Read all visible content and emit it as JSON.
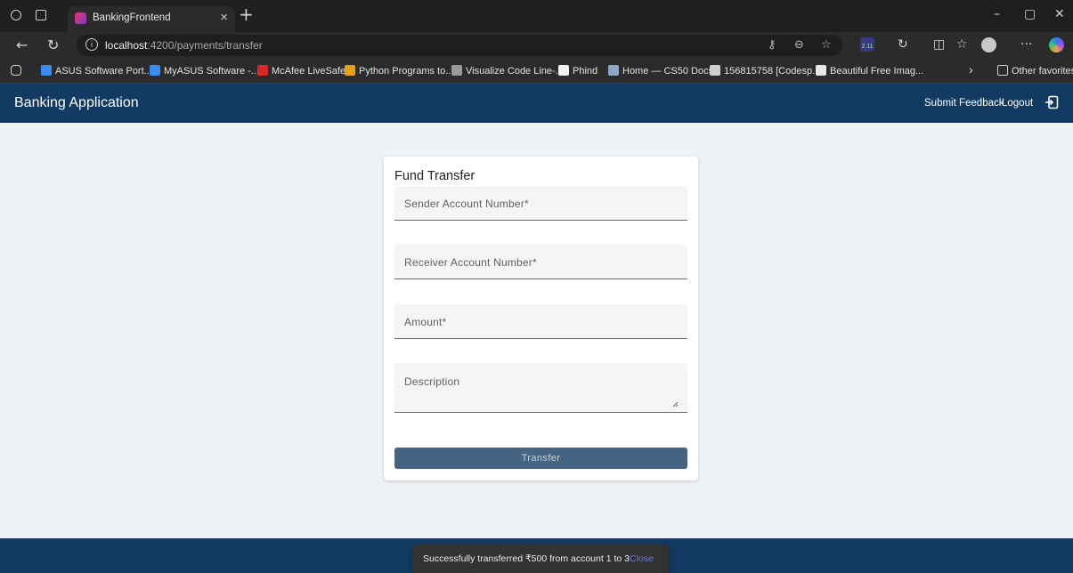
{
  "browser": {
    "tab_title": "BankingFrontend",
    "tab_close": "×",
    "new_tab": "+",
    "url_host": "localhost",
    "url_path": ":4200/payments/transfer",
    "extension_badge": "2.11",
    "window_controls": {
      "minimize": "–",
      "restore": "▢",
      "close": "✕"
    }
  },
  "bookmarks": [
    {
      "label": "ASUS Software Port...",
      "icon": "asus-icon",
      "color": "#3b8cf0"
    },
    {
      "label": "MyASUS Software -...",
      "icon": "asus-icon",
      "color": "#3b8cf0"
    },
    {
      "label": "McAfee LiveSafe",
      "icon": "mcafee-icon",
      "color": "#d92626"
    },
    {
      "label": "Python Programs to...",
      "icon": "python-icon",
      "color": "#e3a21a"
    },
    {
      "label": "Visualize Code Line-...",
      "icon": "visualize-icon",
      "color": "#9a9a9a"
    },
    {
      "label": "Phind",
      "icon": "phind-icon",
      "color": "#f2f2f2"
    },
    {
      "label": "Home — CS50 Docs",
      "icon": "cs50-icon",
      "color": "#8fa6c8"
    },
    {
      "label": "156815758 [Codesp...",
      "icon": "github-icon",
      "color": "#cfcfcf"
    },
    {
      "label": "Beautiful Free Imag...",
      "icon": "unsplash-icon",
      "color": "#e8e8e8"
    }
  ],
  "bookmarks_more": "›",
  "other_favorites": "Other favorites",
  "app": {
    "title": "Banking Application",
    "submit_feedback": "Submit Feedback",
    "logout": "Logout"
  },
  "form": {
    "title": "Fund Transfer",
    "sender_label": "Sender Account Number*",
    "receiver_label": "Receiver Account Number*",
    "amount_label": "Amount*",
    "description_label": "Description",
    "transfer_button": "Transfer"
  },
  "snackbar": {
    "message": "Successfully transferred ₹500 from account 1 to 3",
    "action": "Close"
  },
  "colors": {
    "header": "#123a63",
    "page_bg": "#eef2f6",
    "button": "#456382",
    "snackbar_bg": "#323232",
    "snackbar_action": "#6c7bd6"
  }
}
